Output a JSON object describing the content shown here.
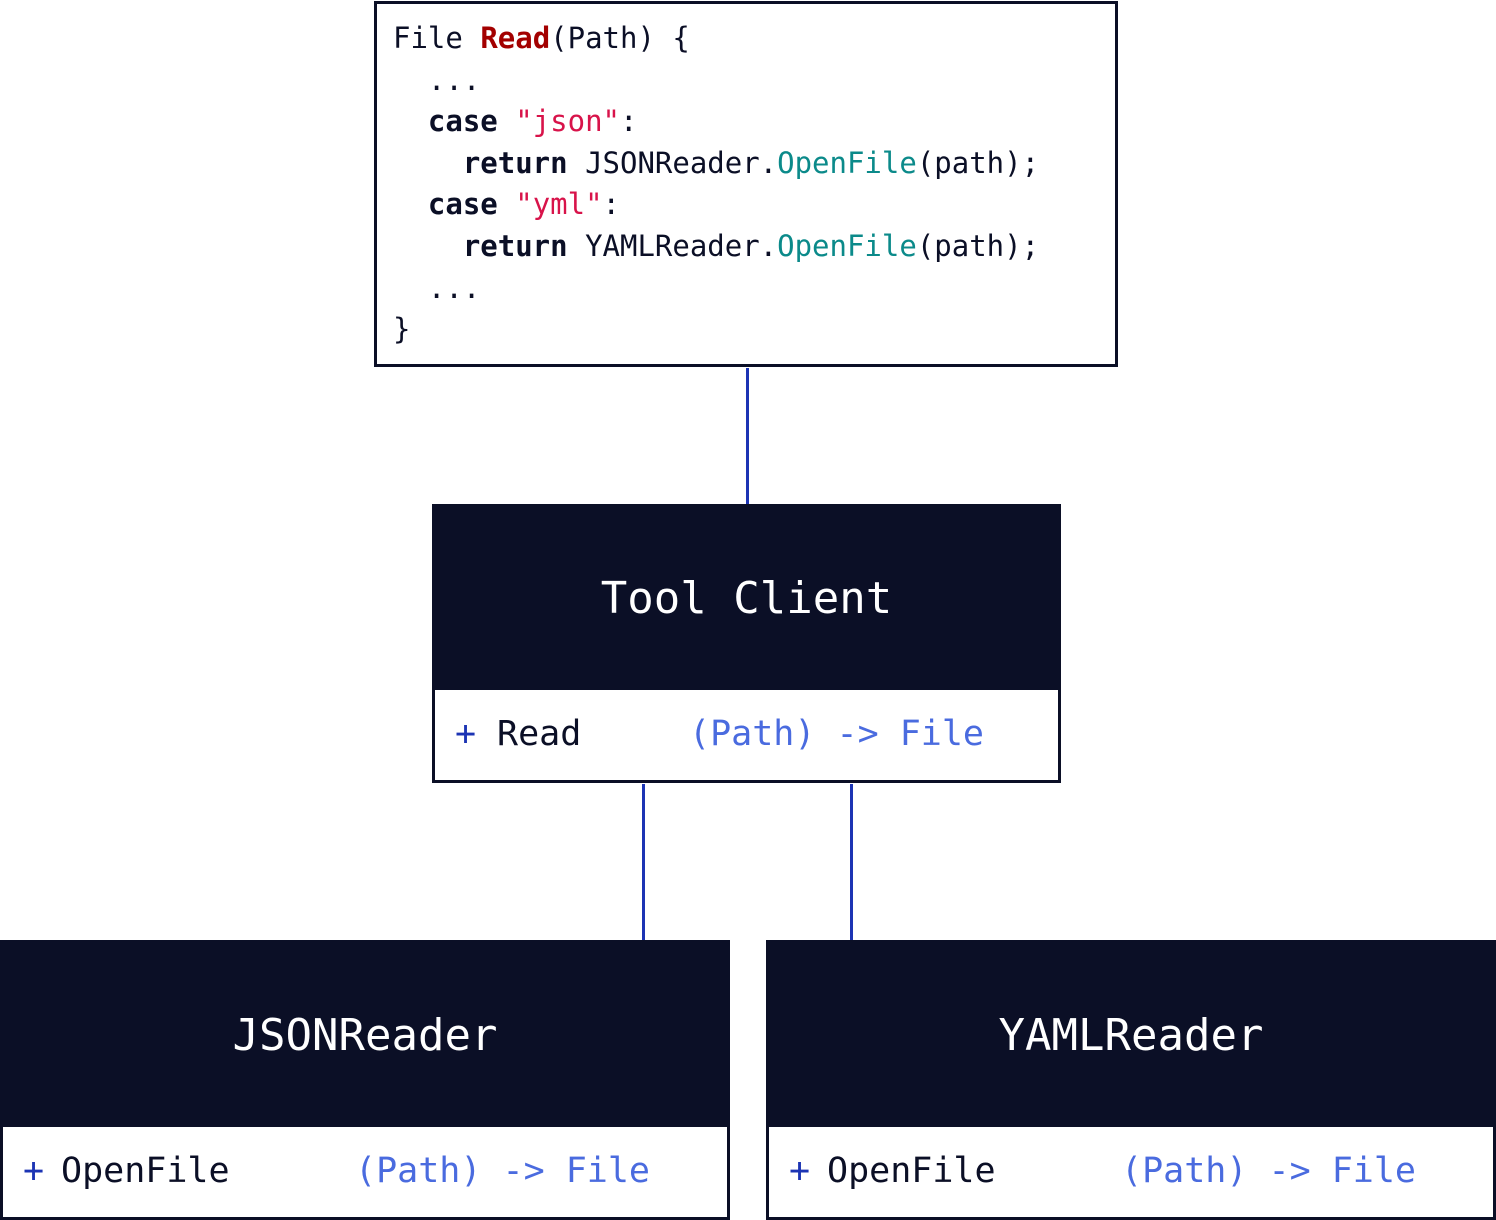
{
  "code": {
    "lines": [
      [
        {
          "t": "File "
        },
        {
          "t": "Read",
          "c": "fn"
        },
        {
          "t": "(Path) {"
        }
      ],
      [
        {
          "t": "  ..."
        }
      ],
      [
        {
          "t": "  "
        },
        {
          "t": "case",
          "c": "kw"
        },
        {
          "t": " "
        },
        {
          "t": "\"json\"",
          "c": "str"
        },
        {
          "t": ":"
        }
      ],
      [
        {
          "t": "    "
        },
        {
          "t": "return",
          "c": "kw"
        },
        {
          "t": " JSONReader."
        },
        {
          "t": "OpenFile",
          "c": "meth"
        },
        {
          "t": "(path);"
        }
      ],
      [
        {
          "t": "  "
        },
        {
          "t": "case",
          "c": "kw"
        },
        {
          "t": " "
        },
        {
          "t": "\"yml\"",
          "c": "str"
        },
        {
          "t": ":"
        }
      ],
      [
        {
          "t": "    "
        },
        {
          "t": "return",
          "c": "kw"
        },
        {
          "t": " YAMLReader."
        },
        {
          "t": "OpenFile",
          "c": "meth"
        },
        {
          "t": "(path);"
        }
      ],
      [
        {
          "t": "  ..."
        }
      ],
      [
        {
          "t": "}"
        }
      ]
    ]
  },
  "tool_client": {
    "title": "Tool Client",
    "method": {
      "plus": "+",
      "name": "Read",
      "signature": "(Path) -> File"
    }
  },
  "json_reader": {
    "title": "JSONReader",
    "method": {
      "plus": "+",
      "name": "OpenFile",
      "signature": "(Path) -> File"
    }
  },
  "yaml_reader": {
    "title": "YAMLReader",
    "method": {
      "plus": "+",
      "name": "OpenFile",
      "signature": "(Path) -> File"
    }
  },
  "colors": {
    "box_dark": "#0b0f26",
    "connector": "#1c34b4",
    "signature": "#4a6bdf",
    "function_name": "#a30000",
    "string": "#d8134a",
    "method_call": "#0b8a8a"
  }
}
